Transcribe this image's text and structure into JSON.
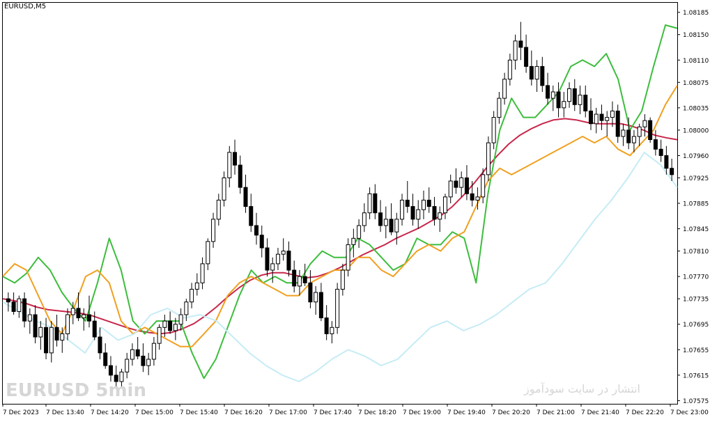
{
  "symbol": "EURUSD,M5",
  "watermark_left": "EURUSD   5min",
  "watermark_right": "انتشار در سایت سودآموز",
  "colors": {
    "bull_candle": "#000000",
    "bear_candle": "#000000",
    "wick": "#000000",
    "line_cyan": "#c6ecf5",
    "line_green": "#3cbd3c",
    "line_orange": "#f0a020",
    "line_crimson": "#c8264a",
    "axis": "#000000"
  },
  "chart_data": {
    "type": "line",
    "title": "EURUSD,M5",
    "ylim": [
      1.0757,
      1.082
    ],
    "y_ticks": [
      "1.08185",
      "1.08150",
      "1.08110",
      "1.08075",
      "1.08035",
      "1.08000",
      "1.07960",
      "1.07925",
      "1.07885",
      "1.07845",
      "1.07810",
      "1.07770",
      "1.07735",
      "1.07695",
      "1.07655",
      "1.07615",
      "1.07575"
    ],
    "x_ticks": [
      "7 Dec 2023",
      "7 Dec 13:40",
      "7 Dec 14:20",
      "7 Dec 15:00",
      "7 Dec 15:40",
      "7 Dec 16:20",
      "7 Dec 17:00",
      "7 Dec 17:40",
      "7 Dec 18:20",
      "7 Dec 19:00",
      "7 Dec 19:40",
      "7 Dec 20:20",
      "7 Dec 21:00",
      "7 Dec 21:40",
      "7 Dec 22:20",
      "7 Dec 23:00"
    ],
    "candles": [
      [
        1.07735,
        1.07745,
        1.07715,
        1.0773
      ],
      [
        1.0773,
        1.07745,
        1.0771,
        1.07715
      ],
      [
        1.07715,
        1.0774,
        1.07705,
        1.07735
      ],
      [
        1.07735,
        1.07745,
        1.0769,
        1.077
      ],
      [
        1.077,
        1.0772,
        1.0768,
        1.0771
      ],
      [
        1.0771,
        1.07725,
        1.07665,
        1.07675
      ],
      [
        1.07675,
        1.077,
        1.07655,
        1.0769
      ],
      [
        1.0769,
        1.07705,
        1.0764,
        1.0765
      ],
      [
        1.0765,
        1.077,
        1.07635,
        1.0769
      ],
      [
        1.0769,
        1.0771,
        1.0766,
        1.0767
      ],
      [
        1.0767,
        1.0769,
        1.0765,
        1.0768
      ],
      [
        1.0768,
        1.0772,
        1.0767,
        1.0771
      ],
      [
        1.0771,
        1.0773,
        1.07695,
        1.0772
      ],
      [
        1.0772,
        1.07745,
        1.077,
        1.07705
      ],
      [
        1.07705,
        1.0772,
        1.07685,
        1.0771
      ],
      [
        1.0771,
        1.0774,
        1.0769,
        1.077
      ],
      [
        1.077,
        1.07715,
        1.0767,
        1.07675
      ],
      [
        1.07675,
        1.0769,
        1.0764,
        1.0765
      ],
      [
        1.0765,
        1.07665,
        1.07625,
        1.0763
      ],
      [
        1.0763,
        1.07645,
        1.07605,
        1.07615
      ],
      [
        1.07615,
        1.0763,
        1.07595,
        1.07605
      ],
      [
        1.07605,
        1.07625,
        1.07595,
        1.0762
      ],
      [
        1.0762,
        1.0765,
        1.0761,
        1.0764
      ],
      [
        1.0764,
        1.07665,
        1.0763,
        1.07655
      ],
      [
        1.07655,
        1.07675,
        1.0764,
        1.07645
      ],
      [
        1.07645,
        1.07665,
        1.0762,
        1.0763
      ],
      [
        1.0763,
        1.0765,
        1.07615,
        1.0764
      ],
      [
        1.0764,
        1.07675,
        1.0763,
        1.07665
      ],
      [
        1.07665,
        1.07695,
        1.07655,
        1.0769
      ],
      [
        1.0769,
        1.0771,
        1.07675,
        1.077
      ],
      [
        1.077,
        1.07715,
        1.0768,
        1.07685
      ],
      [
        1.07685,
        1.07705,
        1.0767,
        1.07695
      ],
      [
        1.07695,
        1.0772,
        1.07685,
        1.0771
      ],
      [
        1.0771,
        1.07735,
        1.077,
        1.0773
      ],
      [
        1.0773,
        1.0776,
        1.0772,
        1.0775
      ],
      [
        1.0775,
        1.07775,
        1.0774,
        1.0776
      ],
      [
        1.0776,
        1.078,
        1.0775,
        1.0779
      ],
      [
        1.0779,
        1.0783,
        1.0778,
        1.07825
      ],
      [
        1.07825,
        1.0787,
        1.07815,
        1.0786
      ],
      [
        1.0786,
        1.079,
        1.0785,
        1.0789
      ],
      [
        1.0789,
        1.07935,
        1.0788,
        1.07925
      ],
      [
        1.07925,
        1.07975,
        1.0791,
        1.07965
      ],
      [
        1.07965,
        1.07985,
        1.0793,
        1.07945
      ],
      [
        1.07945,
        1.0796,
        1.079,
        1.0791
      ],
      [
        1.0791,
        1.0793,
        1.0787,
        1.0788
      ],
      [
        1.0788,
        1.079,
        1.0784,
        1.0785
      ],
      [
        1.0785,
        1.0787,
        1.0782,
        1.07835
      ],
      [
        1.07835,
        1.0785,
        1.078,
        1.07815
      ],
      [
        1.07815,
        1.0783,
        1.0777,
        1.0778
      ],
      [
        1.0778,
        1.078,
        1.0776,
        1.0779
      ],
      [
        1.0779,
        1.07815,
        1.0778,
        1.07805
      ],
      [
        1.07805,
        1.0783,
        1.07795,
        1.0781
      ],
      [
        1.0781,
        1.07825,
        1.0777,
        1.0778
      ],
      [
        1.0778,
        1.07795,
        1.07745,
        1.07755
      ],
      [
        1.07755,
        1.0778,
        1.0774,
        1.0777
      ],
      [
        1.0777,
        1.0779,
        1.07755,
        1.0776
      ],
      [
        1.0776,
        1.0778,
        1.0772,
        1.0773
      ],
      [
        1.0773,
        1.07755,
        1.0771,
        1.07745
      ],
      [
        1.07745,
        1.0776,
        1.077,
        1.07705
      ],
      [
        1.07705,
        1.07725,
        1.0767,
        1.0768
      ],
      [
        1.0768,
        1.077,
        1.07665,
        1.0769
      ],
      [
        1.0769,
        1.0776,
        1.0768,
        1.0775
      ],
      [
        1.0775,
        1.0779,
        1.0774,
        1.0778
      ],
      [
        1.0778,
        1.0783,
        1.0777,
        1.0782
      ],
      [
        1.0782,
        1.07845,
        1.078,
        1.0783
      ],
      [
        1.0783,
        1.0786,
        1.07815,
        1.0785
      ],
      [
        1.0785,
        1.07885,
        1.0784,
        1.0787
      ],
      [
        1.0787,
        1.0791,
        1.0786,
        1.079
      ],
      [
        1.079,
        1.07915,
        1.0786,
        1.0787
      ],
      [
        1.0787,
        1.0789,
        1.0784,
        1.0785
      ],
      [
        1.0785,
        1.0788,
        1.0783,
        1.0786
      ],
      [
        1.0786,
        1.07885,
        1.07835,
        1.0784
      ],
      [
        1.0784,
        1.0787,
        1.0782,
        1.0786
      ],
      [
        1.0786,
        1.079,
        1.0785,
        1.0789
      ],
      [
        1.0789,
        1.0792,
        1.0787,
        1.0788
      ],
      [
        1.0788,
        1.079,
        1.0785,
        1.0786
      ],
      [
        1.0786,
        1.0789,
        1.07845,
        1.07875
      ],
      [
        1.07875,
        1.07905,
        1.0786,
        1.0789
      ],
      [
        1.0789,
        1.0791,
        1.0787,
        1.0788
      ],
      [
        1.0788,
        1.07895,
        1.0785,
        1.0786
      ],
      [
        1.0786,
        1.0788,
        1.0784,
        1.0787
      ],
      [
        1.0787,
        1.079,
        1.0786,
        1.07895
      ],
      [
        1.07895,
        1.0793,
        1.07885,
        1.0792
      ],
      [
        1.0792,
        1.0794,
        1.079,
        1.0791
      ],
      [
        1.0791,
        1.07935,
        1.07895,
        1.07925
      ],
      [
        1.07925,
        1.07945,
        1.0789,
        1.079
      ],
      [
        1.079,
        1.0792,
        1.0788,
        1.0789
      ],
      [
        1.0789,
        1.0791,
        1.07875,
        1.07895
      ],
      [
        1.07895,
        1.0794,
        1.07885,
        1.0793
      ],
      [
        1.0793,
        1.0799,
        1.0792,
        1.0798
      ],
      [
        1.0798,
        1.0803,
        1.0797,
        1.0802
      ],
      [
        1.0802,
        1.0806,
        1.0801,
        1.0805
      ],
      [
        1.0805,
        1.0809,
        1.0804,
        1.0808
      ],
      [
        1.0808,
        1.0812,
        1.0807,
        1.0811
      ],
      [
        1.0811,
        1.0815,
        1.08095,
        1.0814
      ],
      [
        1.0814,
        1.0817,
        1.0811,
        1.0813
      ],
      [
        1.0813,
        1.0815,
        1.0809,
        1.081
      ],
      [
        1.081,
        1.08125,
        1.0807,
        1.0808
      ],
      [
        1.0808,
        1.0811,
        1.0806,
        1.081
      ],
      [
        1.081,
        1.08115,
        1.0806,
        1.0807
      ],
      [
        1.0807,
        1.0809,
        1.0804,
        1.0805
      ],
      [
        1.0805,
        1.0807,
        1.0803,
        1.0806
      ],
      [
        1.0806,
        1.08075,
        1.0802,
        1.08035
      ],
      [
        1.08035,
        1.0806,
        1.0802,
        1.08045
      ],
      [
        1.08045,
        1.08075,
        1.08035,
        1.08065
      ],
      [
        1.08065,
        1.0808,
        1.0803,
        1.0804
      ],
      [
        1.0804,
        1.0807,
        1.08025,
        1.08055
      ],
      [
        1.08055,
        1.0807,
        1.0802,
        1.0803
      ],
      [
        1.0803,
        1.0805,
        1.08,
        1.0801
      ],
      [
        1.0801,
        1.08035,
        1.07995,
        1.08025
      ],
      [
        1.08025,
        1.0804,
        1.08,
        1.08015
      ],
      [
        1.08015,
        1.0803,
        1.0799,
        1.0802
      ],
      [
        1.0802,
        1.08045,
        1.08005,
        1.0803
      ],
      [
        1.0803,
        1.0804,
        1.0798,
        1.0799
      ],
      [
        1.0799,
        1.0801,
        1.07975,
        1.08
      ],
      [
        1.08,
        1.0802,
        1.0797,
        1.0798
      ],
      [
        1.0798,
        1.08,
        1.07965,
        1.0799
      ],
      [
        1.0799,
        1.0801,
        1.07975,
        1.08005
      ],
      [
        1.08005,
        1.08025,
        1.0799,
        1.08015
      ],
      [
        1.08015,
        1.0802,
        1.0798,
        1.07985
      ],
      [
        1.07985,
        1.08,
        1.0796,
        1.0797
      ],
      [
        1.0797,
        1.07985,
        1.0795,
        1.0796
      ],
      [
        1.0796,
        1.07975,
        1.0793,
        1.0794
      ],
      [
        1.0794,
        1.07955,
        1.0792,
        1.0793
      ]
    ],
    "series": [
      {
        "color": "line_crimson",
        "values": [
          1.07735,
          1.07732,
          1.07728,
          1.07722,
          1.07718,
          1.07716,
          1.07714,
          1.07712,
          1.07708,
          1.07702,
          1.07696,
          1.0769,
          1.07685,
          1.07682,
          1.0768,
          1.07682,
          1.07688,
          1.07696,
          1.07708,
          1.07722,
          1.07738,
          1.07752,
          1.07764,
          1.07772,
          1.07776,
          1.07776,
          1.07772,
          1.07768,
          1.0777,
          1.07776,
          1.07784,
          1.07794,
          1.07804,
          1.07812,
          1.0782,
          1.0783,
          1.07838,
          1.07846,
          1.07856,
          1.07866,
          1.0788,
          1.07898,
          1.07918,
          1.0794,
          1.0796,
          1.07978,
          1.07992,
          1.08002,
          1.0801,
          1.08016,
          1.08018,
          1.08016,
          1.08012,
          1.0801,
          1.0801,
          1.0801,
          1.08006,
          1.08,
          1.07992,
          1.07988,
          1.07985
        ]
      },
      {
        "color": "line_green",
        "values": [
          1.0777,
          1.0776,
          1.07775,
          1.078,
          1.0778,
          1.07745,
          1.0772,
          1.077,
          1.0776,
          1.0783,
          1.0778,
          1.077,
          1.0768,
          1.077,
          1.077,
          1.077,
          1.0765,
          1.0761,
          1.0764,
          1.0769,
          1.0774,
          1.0778,
          1.0776,
          1.0777,
          1.0776,
          1.0776,
          1.0779,
          1.0781,
          1.078,
          1.078,
          1.0783,
          1.0782,
          1.078,
          1.0778,
          1.0779,
          1.0783,
          1.0782,
          1.0782,
          1.0784,
          1.0783,
          1.0776,
          1.079,
          1.08,
          1.0805,
          1.0802,
          1.0802,
          1.0804,
          1.0806,
          1.081,
          1.0811,
          1.081,
          1.0812,
          1.0808,
          1.08,
          1.0803,
          1.081,
          1.08165,
          1.0816
        ]
      },
      {
        "color": "line_orange",
        "values": [
          1.0777,
          1.0779,
          1.0778,
          1.0774,
          1.077,
          1.0768,
          1.0772,
          1.0777,
          1.0778,
          1.0776,
          1.077,
          1.0768,
          1.0769,
          1.0768,
          1.0767,
          1.0766,
          1.0766,
          1.0768,
          1.077,
          1.0774,
          1.0776,
          1.0777,
          1.0776,
          1.0775,
          1.0774,
          1.0774,
          1.0776,
          1.0777,
          1.0778,
          1.0778,
          1.078,
          1.078,
          1.0778,
          1.0777,
          1.0779,
          1.0781,
          1.0782,
          1.0781,
          1.0783,
          1.0784,
          1.0788,
          1.0792,
          1.0794,
          1.0793,
          1.0794,
          1.0795,
          1.0796,
          1.0797,
          1.0798,
          1.0799,
          1.0798,
          1.0799,
          1.0797,
          1.0796,
          1.0798,
          1.08,
          1.0804,
          1.0807
        ]
      },
      {
        "color": "line_cyan",
        "values": [
          1.0773,
          1.07715,
          1.077,
          1.0769,
          1.0767,
          1.0765,
          1.0769,
          1.0767,
          1.0768,
          1.0771,
          1.0772,
          1.07705,
          1.0771,
          1.077,
          1.07675,
          1.0765,
          1.0763,
          1.07615,
          1.07605,
          1.0762,
          1.0764,
          1.07655,
          1.07645,
          1.0763,
          1.0764,
          1.07665,
          1.0769,
          1.077,
          1.07685,
          1.07695,
          1.0771,
          1.0773,
          1.0775,
          1.0776,
          1.0779,
          1.07825,
          1.0786,
          1.0789,
          1.07925,
          1.07965,
          1.07945,
          1.0791
        ]
      }
    ]
  }
}
